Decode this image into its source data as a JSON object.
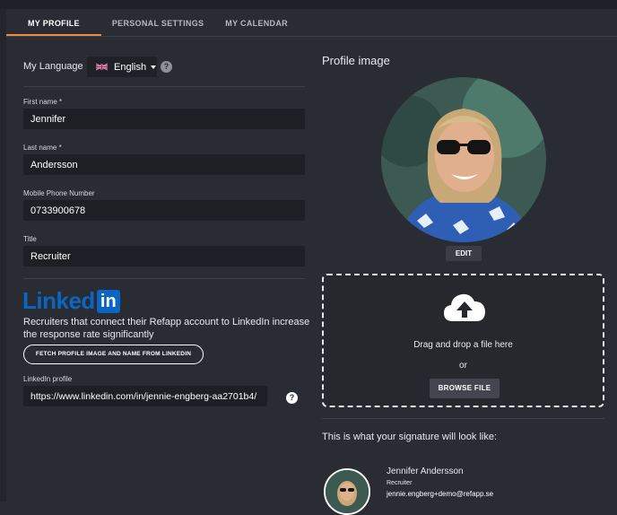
{
  "tabs": [
    {
      "label": "MY PROFILE",
      "active": true
    },
    {
      "label": "PERSONAL SETTINGS",
      "active": false
    },
    {
      "label": "MY CALENDAR",
      "active": false
    }
  ],
  "language": {
    "label": "My Language",
    "selected": "English",
    "flag_icon": "uk-flag-icon",
    "help_icon": "help-icon"
  },
  "fields": {
    "first_name": {
      "label": "First name *",
      "value": "Jennifer"
    },
    "last_name": {
      "label": "Last name *",
      "value": "Andersson"
    },
    "mobile": {
      "label": "Mobile Phone Number",
      "value": "0733900678"
    },
    "title": {
      "label": "Title",
      "value": "Recruiter"
    }
  },
  "linkedin": {
    "logo_word": "Linked",
    "logo_box": "in",
    "description": "Recruiters that connect their Refapp account to LinkedIn increase the response rate significantly",
    "fetch_button": "FETCH PROFILE IMAGE AND NAME FROM LINKEDIN",
    "profile_label": "LinkedIn profile",
    "profile_value": "https://www.linkedin.com/in/jennie-engberg-aa2701b4/",
    "help_icon": "help-icon"
  },
  "profile_image": {
    "title": "Profile image",
    "edit_label": "EDIT",
    "upload_icon": "cloud-upload-icon",
    "drop_text": "Drag and drop a file here",
    "or_text": "or",
    "browse_label": "BROWSE FILE"
  },
  "signature": {
    "intro": "This is what your signature will look like:",
    "name": "Jennifer Andersson",
    "role": "Recruiter",
    "email": "jennie.engberg+demo@refapp.se"
  },
  "colors": {
    "background": "#2a2c33",
    "field_bg": "#1d1f24",
    "active_tab_underline": "#f08a3c",
    "linkedin_blue": "#0a66c2"
  }
}
